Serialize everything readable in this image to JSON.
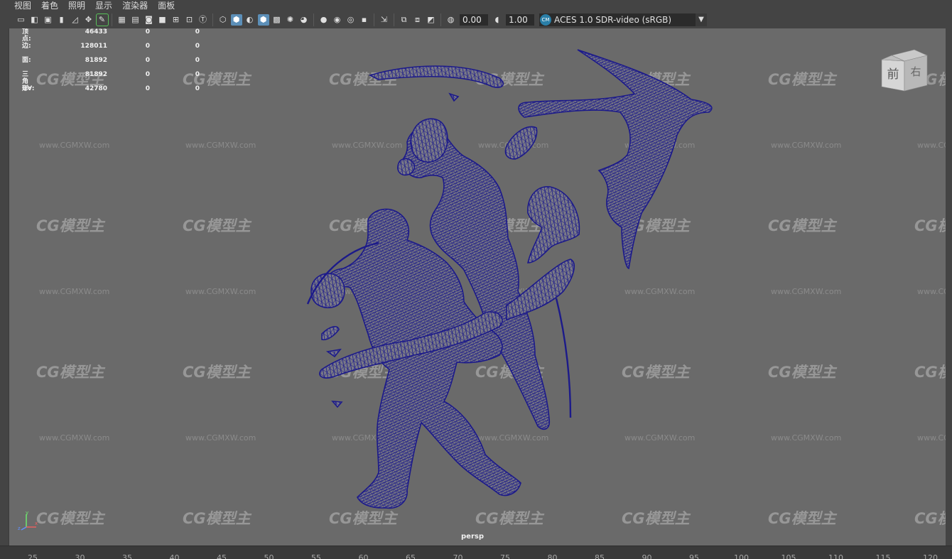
{
  "menu": [
    "视图",
    "着色",
    "照明",
    "显示",
    "渲染器",
    "面板"
  ],
  "toolbar": {
    "exposure_value": "0.00",
    "gamma_value": "1.00",
    "color_management_icon": "color-management-icon",
    "color_management_label": "ACES 1.0 SDR-video (sRGB)"
  },
  "hud": [
    {
      "label": "顶点:",
      "v1": "46433",
      "v2": "0",
      "v3": "0"
    },
    {
      "label": "边:",
      "v1": "128011",
      "v2": "0",
      "v3": "0"
    },
    {
      "label": "面:",
      "v1": "81892",
      "v2": "0",
      "v3": "0"
    },
    {
      "label": "三角形:",
      "v1": "81892",
      "v2": "0",
      "v3": "0"
    },
    {
      "label": "UV:",
      "v1": "42780",
      "v2": "0",
      "v3": "0"
    }
  ],
  "viewcube": {
    "front": "前",
    "right": "右"
  },
  "watermark": {
    "logo": "CG模型主",
    "url": "www.CGMXW.com"
  },
  "camera_name": "persp",
  "ruler_ticks": [
    "25",
    "30",
    "35",
    "40",
    "45",
    "50",
    "55",
    "60",
    "65",
    "70",
    "75",
    "80",
    "85",
    "90",
    "95",
    "100",
    "105",
    "110",
    "115",
    "120"
  ],
  "colors": {
    "wireframe": "#1c1a8a",
    "viewport_bg": "#6a6a6a",
    "ui_bg": "#444444",
    "accent": "#5c8fb8"
  }
}
